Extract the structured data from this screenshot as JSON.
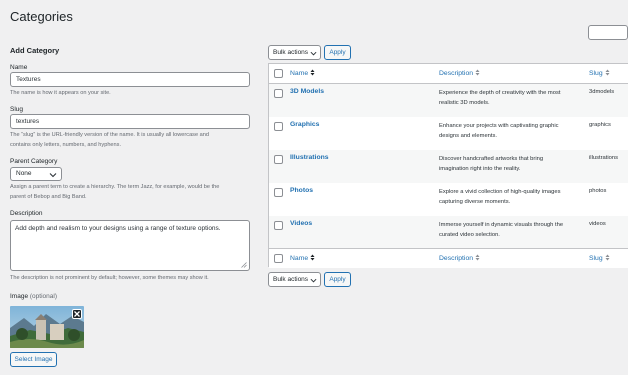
{
  "page": {
    "title": "Categories"
  },
  "form": {
    "heading": "Add Category",
    "name": {
      "label": "Name",
      "value": "Textures",
      "help": "The name is how it appears on your site."
    },
    "slug": {
      "label": "Slug",
      "value": "textures",
      "help_line1": "The “slug” is the URL-friendly version of the name. It is usually all lowercase and",
      "help_line2": "contains only letters, numbers, and hyphens."
    },
    "parent": {
      "label": "Parent Category",
      "value": "None",
      "help_line1": "Assign a parent term to create a hierarchy. The term Jazz, for example, would be the",
      "help_line2": "parent of Bebop and Big Band."
    },
    "description": {
      "label": "Description",
      "value": "Add depth and realism to your designs using a range of texture options.",
      "help": "The description is not prominent by default; however, some themes may show it."
    },
    "image": {
      "label": "Image",
      "optional": "(optional)",
      "button": "Select Image"
    }
  },
  "bulk": {
    "label": "Bulk actions",
    "apply": "Apply"
  },
  "table": {
    "columns": {
      "name": "Name",
      "description": "Description",
      "slug": "Slug"
    },
    "rows": [
      {
        "name": "3D Models",
        "desc_line1": "Experience the depth of creativity with the most",
        "desc_line2": "realistic 3D models.",
        "slug": "3dmodels"
      },
      {
        "name": "Graphics",
        "desc_line1": "Enhance your projects with captivating graphic",
        "desc_line2": "designs and elements.",
        "slug": "graphics"
      },
      {
        "name": "Illustrations",
        "desc_line1": "Discover handcrafted artworks that bring",
        "desc_line2": "imagination right into the reality.",
        "slug": "illustrations"
      },
      {
        "name": "Photos",
        "desc_line1": "Explore a vivid collection of high-quality images",
        "desc_line2": "capturing diverse moments.",
        "slug": "photos"
      },
      {
        "name": "Videos",
        "desc_line1": "Immerse yourself in dynamic visuals through the",
        "desc_line2": "curated video selection.",
        "slug": "videos"
      }
    ]
  },
  "icons": {
    "caret": "chevron-down-icon",
    "sort": "sort-icon",
    "close": "close-icon"
  },
  "colors": {
    "accent": "#2271b1",
    "background": "#f0f0f1",
    "text": "#1d2327",
    "muted": "#646970"
  }
}
